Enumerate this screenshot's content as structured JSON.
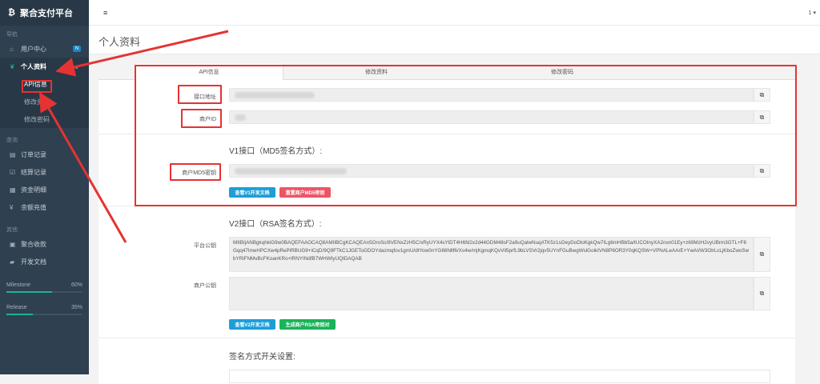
{
  "brand": {
    "icon": "₿",
    "name": "聚合支付平台"
  },
  "sidebar": {
    "sec_nav": "导航",
    "user_center": "用户中心",
    "user_center_badge": "N",
    "profile": "个人资料",
    "sub": [
      "API信息",
      "修改资料",
      "修改密码"
    ],
    "sec_query": "查询",
    "query_items": [
      "订单记录",
      "结算记录",
      "资金明细",
      "余额充值"
    ],
    "sec_other": "其他",
    "other_items": [
      "聚合收款",
      "开发文档"
    ],
    "progress": [
      {
        "label": "Milestone",
        "value": "60%",
        "fraction": 0.6
      },
      {
        "label": "Release",
        "value": "35%",
        "fraction": 0.35
      }
    ]
  },
  "topbar": {
    "menu_icon": "≡",
    "right_label": "1 ▾"
  },
  "page_title": "个人资料",
  "tabs": [
    "API信息",
    "修改资料",
    "修改密码"
  ],
  "api": {
    "endpoint_label": "接口地址",
    "merchant_id_label": "商户ID",
    "v1_title": "V1接口（MD5签名方式）:",
    "md5_label": "商户MD5密钥",
    "btn_v1_doc": "查看V1开发文档",
    "btn_reset_md5": "重置商户MD5密钥",
    "v2_title": "V2接口（RSA签名方式）:",
    "platform_pubkey_label": "平台公钥",
    "platform_pubkey": "MIIBIjANBgkqhkiG9w0BAQEFAAOCAQ8AMIIBCgKCAQEAn5OroSc/8VENxZzH5C/xRyUYX4sYlDT4H6fd2x2d44GDM48sF2a9uQalwNuqATK5z1sOeyDoDloKgkQw7ILg6mHBb5a/tUCOtnyXA2nxn01Ey+z69MzH2vyUBrm3GTL+F8Gqq47ImeHPCXw4pRePiRBUG9+iCqD/9Q9FTkC1JGEToGDOYdazmqfov1gmU/dtYow0nYG86Nllf6/Xs4w/mjKgmqKQvVil5prfL9bLVSVr2jqv5UYnFGuBwgWslGoikIVN8P8OR3Y0qKQSW+VPNALeAArE+YwAI/W3OlrLcLjKboZwoSwbYRiFNMvBcFKoanKRo+lRNYINdfB7WHWIyUQIDAQAB",
    "merchant_pubkey_label": "商户公钥",
    "btn_v2_doc": "查看V2开发文档",
    "btn_gen_rsa": "生成商户RSA密钥对",
    "sign_switch_title": "签名方式开关设置:"
  },
  "colors": {
    "sidebar": "#2f4050",
    "annotation_red": "#e53333",
    "blue": "#1c9ed8",
    "red": "#ed5565",
    "green": "#19b35a"
  }
}
